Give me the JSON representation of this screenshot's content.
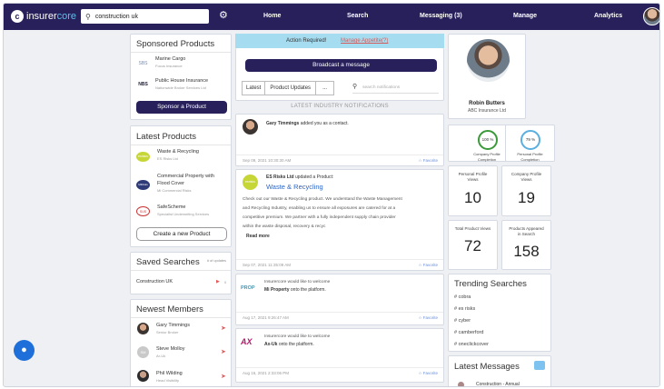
{
  "topbar": {
    "logo_text_prefix": "insurer",
    "logo_text_suffix": "core",
    "search_value": "construction uk",
    "nav": [
      "Home",
      "Search",
      "Messaging (3)",
      "Manage",
      "Analytics"
    ]
  },
  "sponsored": {
    "title": "Sponsored Products",
    "items": [
      {
        "title": "Marine Cargo",
        "sub": "Focus Insurance"
      },
      {
        "title": "Public House Insurance",
        "sub": "Nationwide Broker Services Ltd"
      }
    ],
    "button": "Sponsor a Product"
  },
  "latest_products": {
    "title": "Latest Products",
    "items": [
      {
        "title": "Waste & Recycling",
        "sub": "ES Risks Ltd",
        "logo": "esrisks"
      },
      {
        "title": "Commercial Property with",
        "title2": "Flood Cover",
        "sub": "Mi Commercial Risks",
        "logo": "MiRisks"
      },
      {
        "title": "SafeScheme",
        "sub": "Specialist Underwriting Services",
        "logo": "SUS"
      }
    ],
    "button": "Create a new Product"
  },
  "saved_searches": {
    "title": "Saved Searches",
    "col_label": "# of updates",
    "items": [
      {
        "name": "Construction UK",
        "count": "0"
      }
    ]
  },
  "newest_members": {
    "title": "Newest Members",
    "items": [
      {
        "name": "Gary Timmings",
        "sub": "Senior Broker"
      },
      {
        "name": "Steve Molloy",
        "sub": "Ar-Uk"
      },
      {
        "name": "Phil Wilding",
        "sub": "Head Visibility"
      }
    ]
  },
  "action": {
    "label": "Action Required!",
    "link": "Manage Appetite(?)",
    "broadcast": "Broadcast a message"
  },
  "filters": {
    "tabs": [
      "Latest",
      "Product Updates",
      "..."
    ],
    "search_placeholder": "search notifications"
  },
  "feed": {
    "header": "LATEST INDUSTRY NOTIFICATIONS",
    "items": [
      {
        "actor": "Gary Timmings",
        "action": "added you as a contact.",
        "date": "Sep 09, 2021 10:30:30 AM",
        "fav": "Favorite"
      },
      {
        "actor": "ES Risks Ltd",
        "action": "updated a Product:",
        "product": "Waste & Recycling",
        "lines": [
          "Check out our Waste & Recycling product. We understand the Waste Management",
          "and Recycling Industry, enabling us to ensure all exposures are catered for at a",
          "competitive premium. We partner with a fully independent supply chain provider",
          "within the waste disposal, recovery & recyc"
        ],
        "read_more": "Read more",
        "date": "Sep 07, 2021 11:35:09 AM",
        "fav": "Favorite"
      },
      {
        "line1": "Insurercore would like to welcome",
        "name": "Mi Property",
        "line2": "onto the platform.",
        "date": "Aug 17, 2021 9:26:47 AM",
        "fav": "Favorite",
        "logo": "PROP"
      },
      {
        "line1": "Insurercore would like to welcome",
        "name": "Ax-Uk",
        "line2": "onto the platform.",
        "date": "Aug 16, 2021 2:33:06 PM",
        "fav": "Favorite",
        "logo": "AX"
      }
    ]
  },
  "profile": {
    "name": "Robin Butters",
    "company": "ABC Insurance Ltd"
  },
  "completion": [
    {
      "value": "100 %",
      "label1": "Company Profile",
      "label2": "Completion",
      "color": "#3a9a3a"
    },
    {
      "value": "79 %",
      "label1": "Personal Profile",
      "label2": "Completion",
      "color": "#5aaee0"
    }
  ],
  "stats": [
    {
      "label1": "Personal Profile",
      "label2": "Views",
      "value": "10"
    },
    {
      "label1": "Company Profile",
      "label2": "Views",
      "value": "19"
    },
    {
      "label1": "Total Product Views",
      "label2": "",
      "value": "72"
    },
    {
      "label1": "Products Appeared",
      "label2": "in Search",
      "value": "158"
    }
  ],
  "trending": {
    "title": "Trending Searches",
    "items": [
      "# cobra",
      "# es risks",
      "# cyber",
      "# camberford",
      "# oneclickcover"
    ]
  },
  "messages": {
    "title": "Latest Messages",
    "preview": "Construction - Annual"
  }
}
